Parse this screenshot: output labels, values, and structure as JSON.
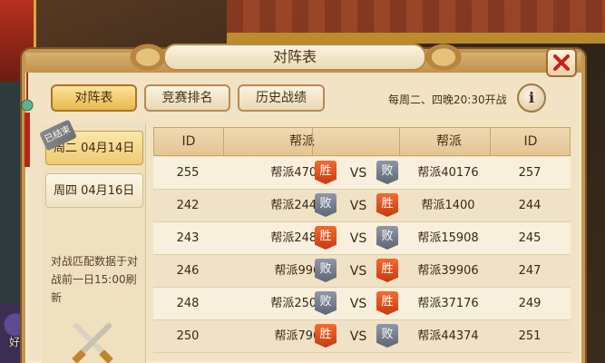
{
  "title": "对阵表",
  "tabs": [
    {
      "label": "对阵表",
      "active": true
    },
    {
      "label": "竞赛排名",
      "active": false
    },
    {
      "label": "历史战绩",
      "active": false
    }
  ],
  "schedule_text": "每周二、四晚20:30开战",
  "info_icon": "i",
  "dates": [
    {
      "label": "周二  04月14日",
      "active": true,
      "badge": "已结束"
    },
    {
      "label": "周四  04月16日",
      "active": false
    }
  ],
  "match_note": "对战匹配数据于对战前一日15:00刷新",
  "background_label": "好友",
  "table": {
    "headers": [
      "ID",
      "帮派",
      "帮派",
      "ID"
    ],
    "vs_label": "VS",
    "win_label": "胜",
    "lose_label": "败",
    "rows": [
      {
        "id1": "255",
        "guild1": "帮派47058",
        "result1": "win",
        "guild2": "帮派40176",
        "id2": "257",
        "result2": "lose"
      },
      {
        "id1": "242",
        "guild1": "帮派24460",
        "result1": "lose",
        "guild2": "帮派1400",
        "id2": "244",
        "result2": "win"
      },
      {
        "id1": "243",
        "guild1": "帮派24804",
        "result1": "win",
        "guild2": "帮派15908",
        "id2": "245",
        "result2": "lose"
      },
      {
        "id1": "246",
        "guild1": "帮派9969",
        "result1": "lose",
        "guild2": "帮派39906",
        "id2": "247",
        "result2": "win"
      },
      {
        "id1": "248",
        "guild1": "帮派25028",
        "result1": "lose",
        "guild2": "帮派37176",
        "id2": "249",
        "result2": "win"
      },
      {
        "id1": "250",
        "guild1": "帮派7962",
        "result1": "win",
        "guild2": "帮派44374",
        "id2": "251",
        "result2": "lose"
      }
    ]
  },
  "colors": {
    "win": "#e2521c",
    "lose": "#6f7987",
    "active_tab": "#e8b94c"
  }
}
